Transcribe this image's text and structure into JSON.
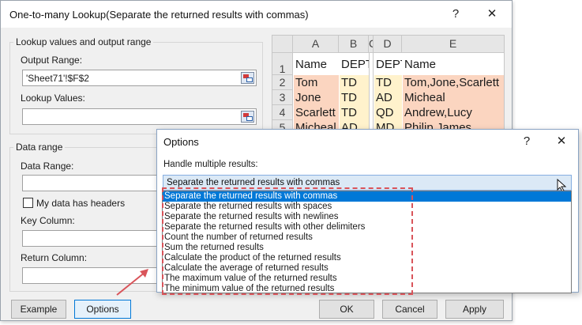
{
  "main_dialog": {
    "title": "One-to-many Lookup(Separate the returned results with commas)",
    "help_glyph": "?",
    "close_glyph": "✕",
    "lookup_group": {
      "title": "Lookup values and output range",
      "output_range_label": "Output Range:",
      "output_range_value": "'Sheet71'!$F$2",
      "lookup_values_label": "Lookup Values:",
      "lookup_values_value": ""
    },
    "data_group": {
      "title": "Data range",
      "data_range_label": "Data Range:",
      "headers_checkbox_label": "My data has headers",
      "key_column_label": "Key Column:",
      "return_column_label": "Return Column:"
    },
    "buttons": {
      "example": "Example",
      "options": "Options",
      "ok": "OK",
      "cancel": "Cancel",
      "apply": "Apply"
    }
  },
  "sheet_preview": {
    "column_headers": [
      "A",
      "B",
      "C",
      "D",
      "E"
    ],
    "row_headers": [
      "1",
      "2",
      "3",
      "4",
      "5"
    ],
    "left_table": {
      "header": [
        "Name",
        "DEPT"
      ],
      "rows": [
        [
          "Tom",
          "TD"
        ],
        [
          "Jone",
          "TD"
        ],
        [
          "Scarlett",
          "TD"
        ],
        [
          "Micheal",
          "AD"
        ]
      ]
    },
    "right_table": {
      "header": [
        "DEPT",
        "Name"
      ],
      "rows": [
        [
          "TD",
          "Tom,Jone,Scarlett"
        ],
        [
          "AD",
          "Micheal"
        ],
        [
          "QD",
          "Andrew,Lucy"
        ],
        [
          "MD",
          "Philip,James"
        ]
      ]
    },
    "colors": {
      "name_fill": "#fbd5c0",
      "dept_fill": "#fff2cc",
      "result_fill": "#fbd5c0"
    }
  },
  "options_dialog": {
    "title": "Options",
    "help_glyph": "?",
    "close_glyph": "✕",
    "handle_label": "Handle multiple results:",
    "selected_value": "Separate the returned results with commas",
    "options": [
      "Separate the returned results with commas",
      "Separate the returned results with spaces",
      "Separate the returned results with newlines",
      "Separate the returned results with other delimiters",
      "Count the number of returned results",
      "Sum the returned results",
      "Calculate the product of the returned results",
      "Calculate the average of returned results",
      "The maximum value of the returned results",
      "The minimum value of the returned results"
    ]
  },
  "colors": {
    "accent": "#0078d7",
    "annotation": "#d9545a",
    "select_fill": "#dbe9f6"
  }
}
